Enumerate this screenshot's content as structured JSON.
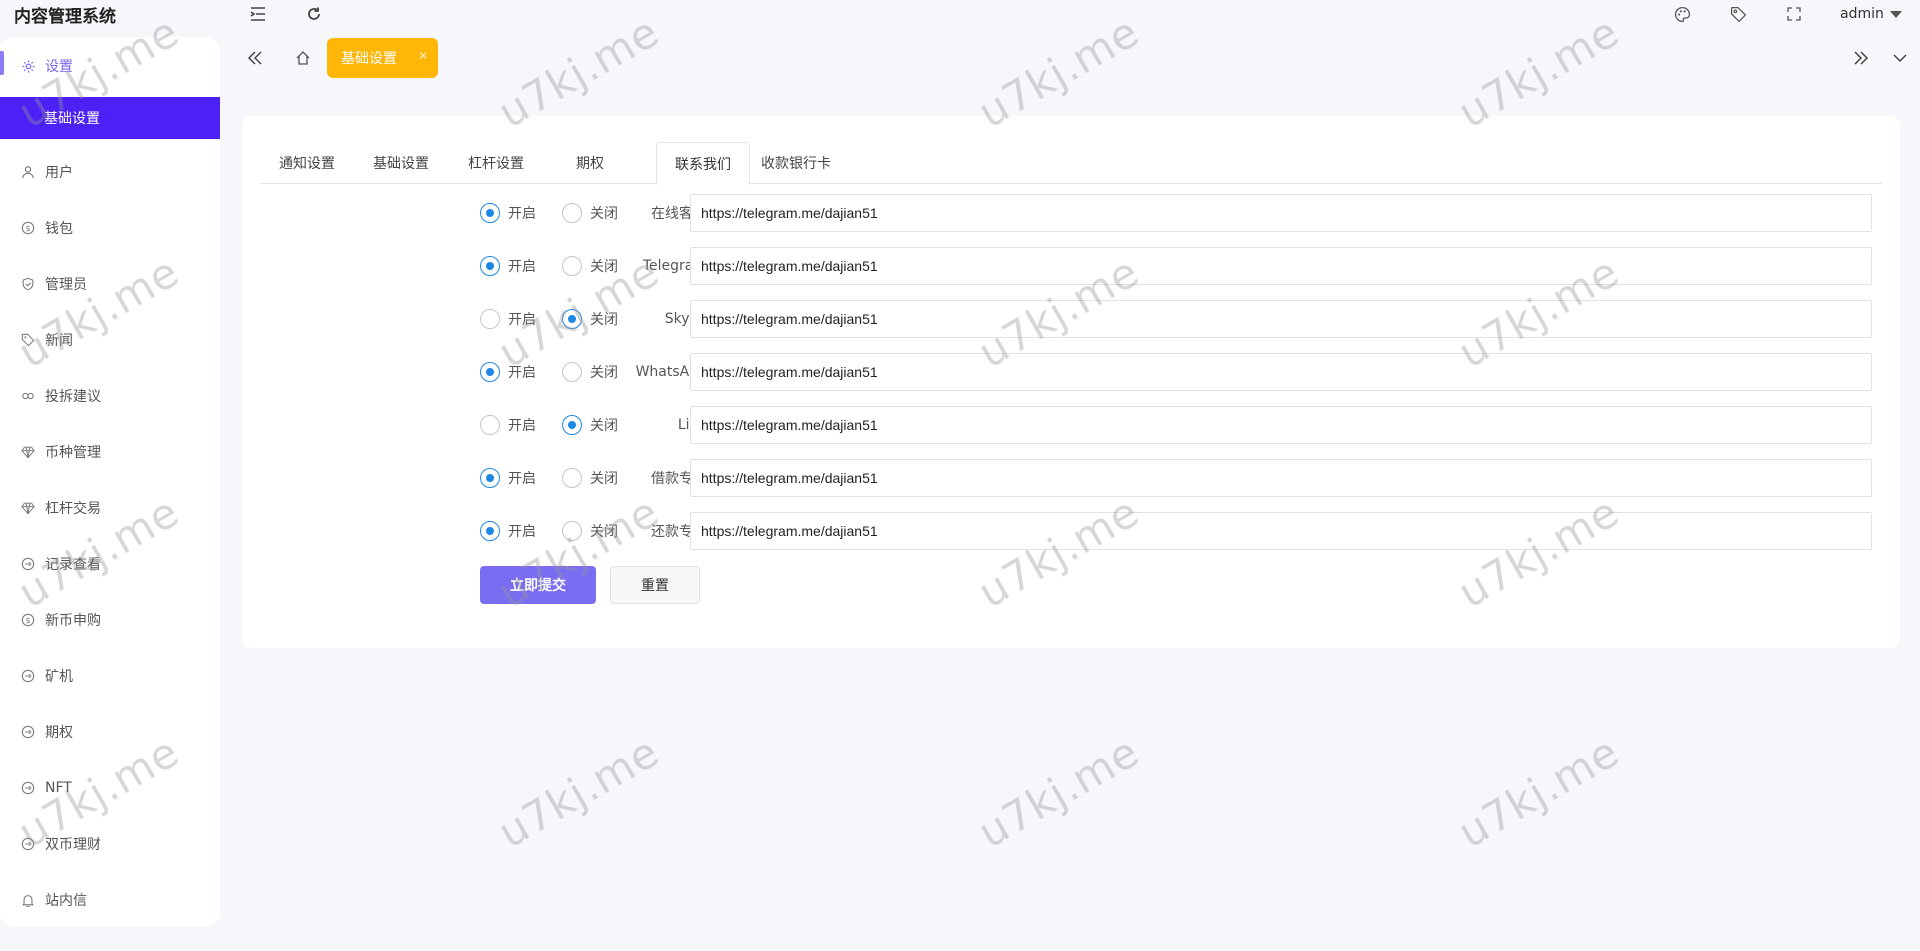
{
  "app": {
    "title": "内容管理系统"
  },
  "header": {
    "user": "admin"
  },
  "sidebar": {
    "items": [
      {
        "label": "设置",
        "icon": "gear-icon"
      },
      {
        "label": "基础设置",
        "icon": ""
      },
      {
        "label": "用户",
        "icon": "user-icon"
      },
      {
        "label": "钱包",
        "icon": "dollar-icon"
      },
      {
        "label": "管理员",
        "icon": "shield-icon"
      },
      {
        "label": "新闻",
        "icon": "tag-icon"
      },
      {
        "label": "投拆建议",
        "icon": "link-icon"
      },
      {
        "label": "币种管理",
        "icon": "diamond-icon"
      },
      {
        "label": "杠杆交易",
        "icon": "diamond-icon"
      },
      {
        "label": "记录查看",
        "icon": "cart-icon"
      },
      {
        "label": "新币申购",
        "icon": "dollar-icon"
      },
      {
        "label": "矿机",
        "icon": "cart-icon"
      },
      {
        "label": "期权",
        "icon": "cart-icon"
      },
      {
        "label": "NFT",
        "icon": "cart-icon"
      },
      {
        "label": "双币理财",
        "icon": "cart-icon"
      },
      {
        "label": "站内信",
        "icon": "bell-icon"
      }
    ]
  },
  "pagetab": {
    "label": "基础设置"
  },
  "tabs": [
    {
      "label": "通知设置",
      "active": false
    },
    {
      "label": "基础设置",
      "active": false
    },
    {
      "label": "杠杆设置",
      "active": false
    },
    {
      "label": "期权",
      "active": false
    },
    {
      "label": "联系我们",
      "active": true
    },
    {
      "label": "收款银行卡",
      "active": false
    }
  ],
  "form": {
    "on_label": "开启",
    "off_label": "关闭",
    "rows": [
      {
        "label": "在线客服",
        "enabled": true,
        "value": "https://telegram.me/dajian51"
      },
      {
        "label": "Telegram",
        "enabled": true,
        "value": "https://telegram.me/dajian51"
      },
      {
        "label": "Skype",
        "enabled": false,
        "value": "https://telegram.me/dajian51"
      },
      {
        "label": "WhatsApp",
        "enabled": true,
        "value": "https://telegram.me/dajian51"
      },
      {
        "label": "Line",
        "enabled": false,
        "value": "https://telegram.me/dajian51"
      },
      {
        "label": "借款专员",
        "enabled": true,
        "value": "https://telegram.me/dajian51"
      },
      {
        "label": "还款专员",
        "enabled": true,
        "value": "https://telegram.me/dajian51"
      }
    ],
    "submit_label": "立即提交",
    "reset_label": "重置"
  },
  "watermark": {
    "text": "u7kj.me"
  },
  "colors": {
    "accent": "#4b21f5",
    "tag": "#ffb606",
    "radio": "#1e88e5",
    "primary_button": "#7a6df2"
  }
}
